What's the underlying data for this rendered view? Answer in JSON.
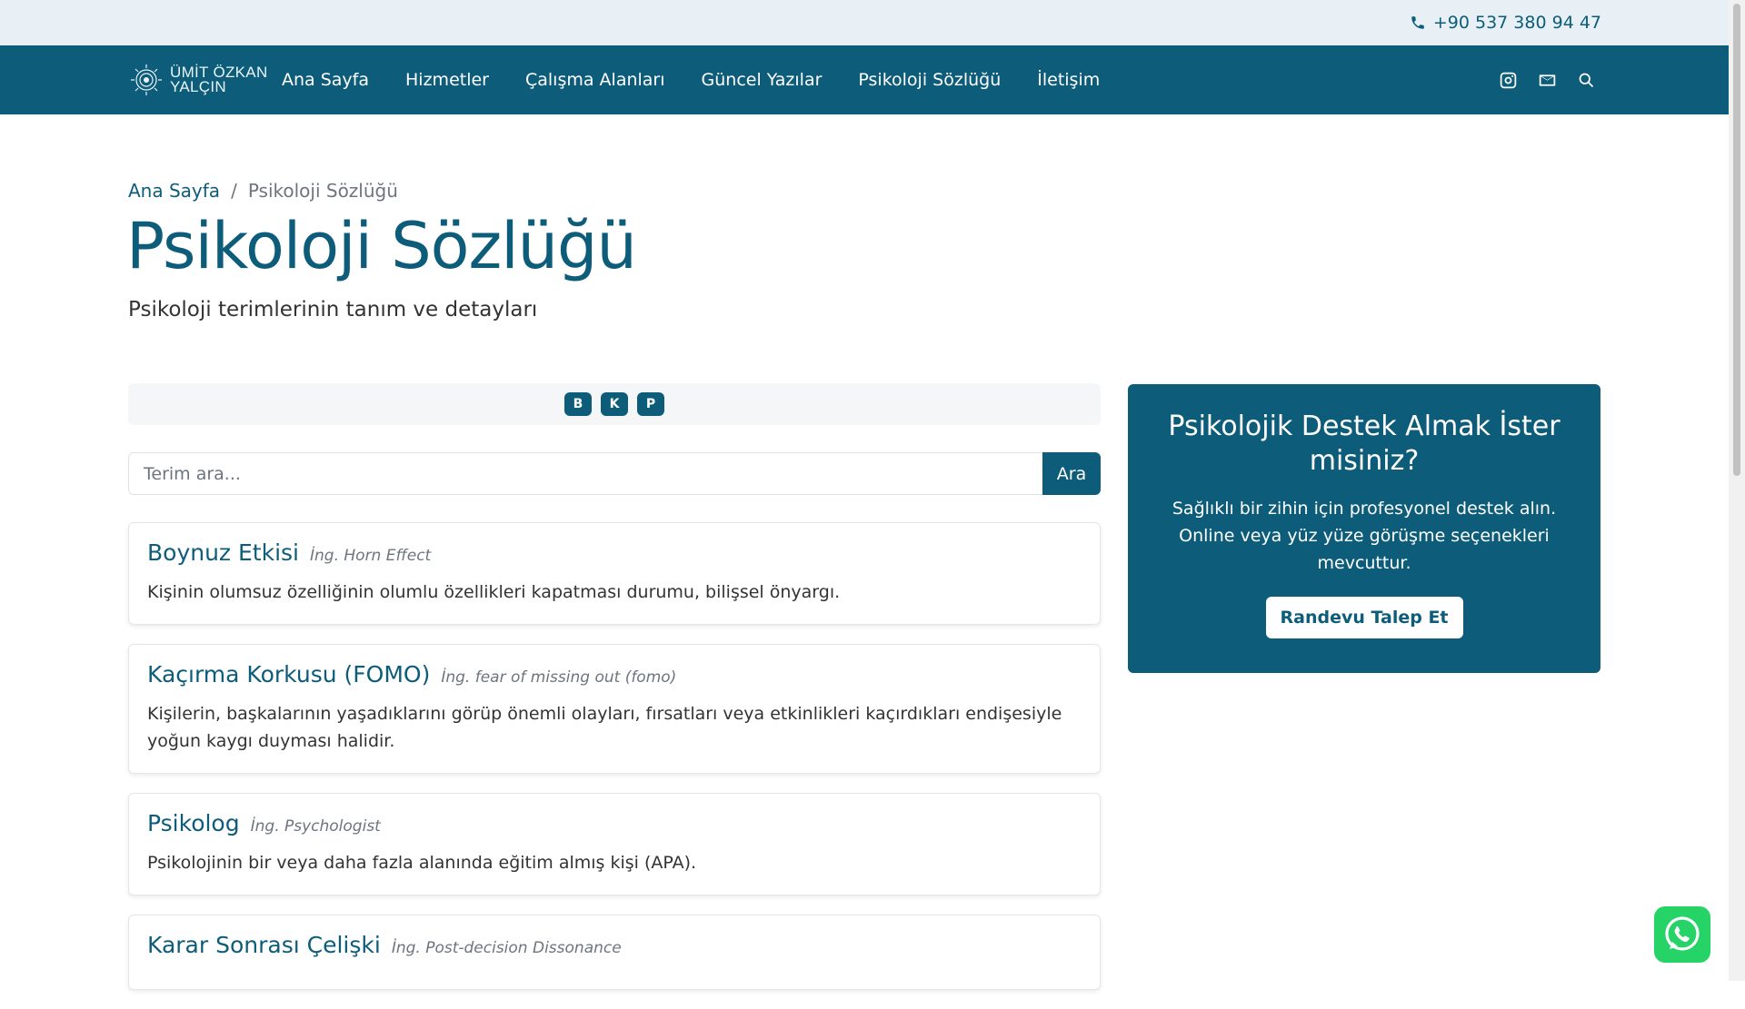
{
  "topbar": {
    "phone": "+90 537 380 94 47"
  },
  "nav": {
    "logo_text": "ÜMİT ÖZKAN YALÇIN",
    "items": [
      "Ana Sayfa",
      "Hizmetler",
      "Çalışma Alanları",
      "Güncel Yazılar",
      "Psikoloji Sözlüğü",
      "İletişim"
    ],
    "icons": [
      "instagram-icon",
      "mail-icon",
      "search-icon"
    ]
  },
  "breadcrumb": {
    "home": "Ana Sayfa",
    "separator": "/",
    "current": "Psikoloji Sözlüğü"
  },
  "header": {
    "title": "Psikoloji Sözlüğü",
    "subtitle": "Psikoloji terimlerinin tanım ve detayları"
  },
  "letters": [
    "B",
    "K",
    "P"
  ],
  "search": {
    "placeholder": "Terim ara...",
    "button": "Ara"
  },
  "terms": [
    {
      "name": "Boynuz Etkisi",
      "en": "İng. Horn Effect",
      "definition": "Kişinin olumsuz özelliğinin olumlu özellikleri kapatması durumu, bilişsel önyargı."
    },
    {
      "name": "Kaçırma Korkusu (FOMO)",
      "en": "İng. fear of missing out (fomo)",
      "definition": "Kişilerin, başkalarının yaşadıklarını görüp önemli olayları, fırsatları veya etkinlikleri kaçırdıkları endişesiyle yoğun kaygı duyması halidir."
    },
    {
      "name": "Psikolog",
      "en": "İng. Psychologist",
      "definition": "Psikolojinin bir veya daha fazla alanında eğitim almış kişi (APA)."
    },
    {
      "name": "Karar Sonrası Çelişki",
      "en": "İng. Post-decision Dissonance",
      "definition": ""
    }
  ],
  "cta": {
    "title": "Psikolojik Destek Almak İster misiniz?",
    "text": "Sağlıklı bir zihin için profesyonel destek alın. Online veya yüz yüze görüşme seçenekleri mevcuttur.",
    "button": "Randevu Talep Et"
  },
  "colors": {
    "primary": "#0d5c7a",
    "topbar": "#e8f0f5",
    "whatsapp": "#25d366"
  }
}
